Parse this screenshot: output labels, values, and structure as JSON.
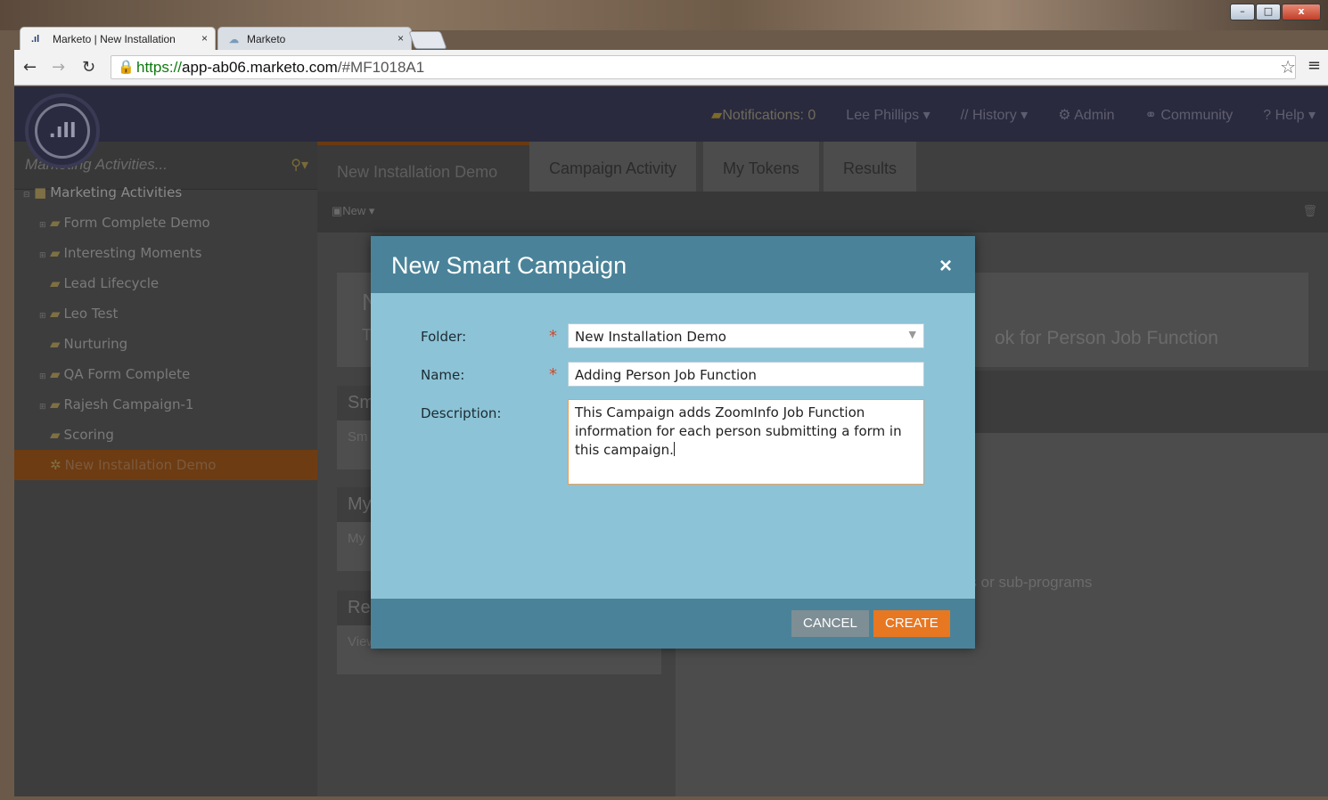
{
  "browser": {
    "tabs": [
      {
        "label": "Marketo | New Installation",
        "close": "×"
      },
      {
        "label": "Marketo",
        "close": "×"
      }
    ],
    "url_secure": "https://",
    "url_host": "app-ab06.marketo.com",
    "url_path": "/#MF1018A1",
    "window_controls": [
      "–",
      "□",
      "x"
    ]
  },
  "app": {
    "logo_text": ".ıll",
    "topnav": {
      "notifications": "Notifications: 0",
      "user": "Lee Phillips",
      "history": "History",
      "admin": "Admin",
      "community": "Community",
      "help": "Help"
    },
    "sidebar": {
      "search_placeholder": "Marketing Activities...",
      "tree": [
        {
          "label": "Marketing Activities",
          "level": "root"
        },
        {
          "label": "Form Complete Demo",
          "level": "child"
        },
        {
          "label": "Interesting Moments",
          "level": "child"
        },
        {
          "label": "Lead Lifecycle",
          "level": "nochild"
        },
        {
          "label": "Leo Test",
          "level": "child"
        },
        {
          "label": "Nurturing",
          "level": "nochild"
        },
        {
          "label": "QA Form Complete",
          "level": "child"
        },
        {
          "label": "Rajesh Campaign-1",
          "level": "child"
        },
        {
          "label": "Scoring",
          "level": "nochild"
        },
        {
          "label": "New Installation Demo",
          "level": "selected"
        }
      ]
    },
    "program_tabs": [
      "New Installation Demo",
      "Campaign Activity",
      "My Tokens",
      "Results"
    ],
    "toolbar_new": "New",
    "background": {
      "title_fragment": "N",
      "subtitle_fragment": "T",
      "right_text": "ok for Person Job Function",
      "panel1_head": "Sm",
      "panel1_body": "Sm",
      "panel2_head": "My",
      "panel2_body": "My",
      "panel3_head": "Re",
      "panel3_body": "View combined campaign activity",
      "sub_programs_text": "ns or sub-programs"
    }
  },
  "modal": {
    "title": "New Smart Campaign",
    "close": "×",
    "folder_label": "Folder:",
    "folder_value": "New Installation Demo",
    "name_label": "Name:",
    "name_value": "Adding Person Job Function",
    "description_label": "Description:",
    "description_value": "This Campaign adds ZoomInfo Job Function information for each person submitting a form in this campaign.",
    "required_mark": "*",
    "cancel_label": "CANCEL",
    "create_label": "CREATE",
    "colors": {
      "header": "#4a8399",
      "body": "#8cc3d6",
      "create": "#e87722",
      "cancel": "#7e8e95"
    }
  }
}
